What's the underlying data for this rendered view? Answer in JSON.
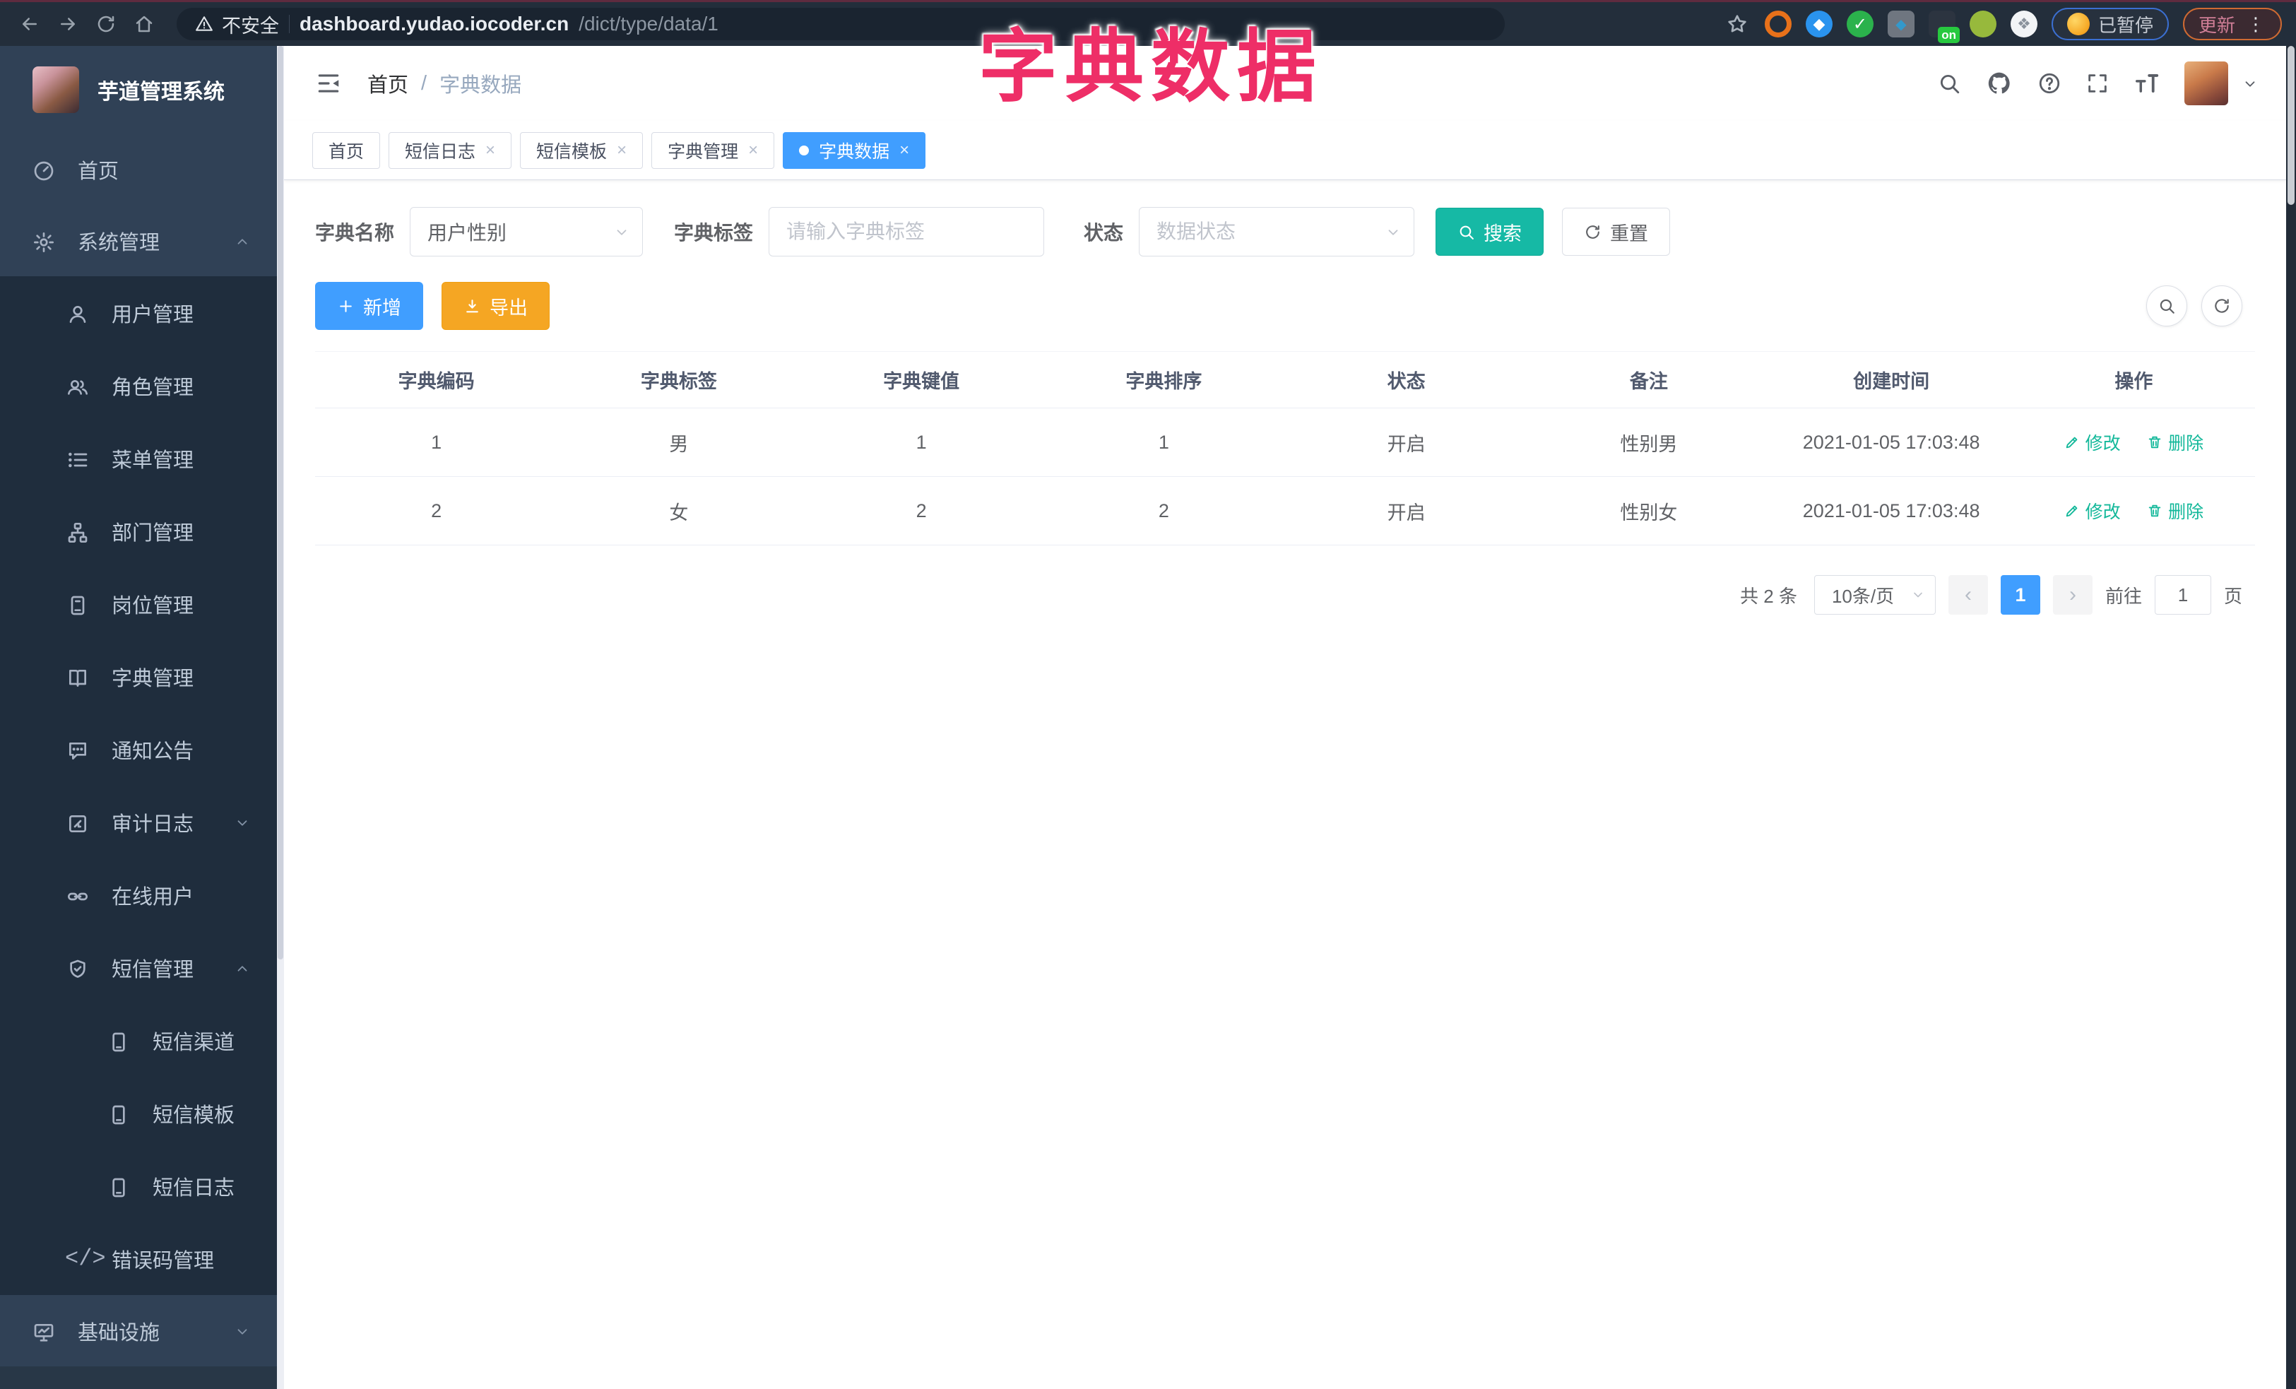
{
  "browser": {
    "security_label": "不安全",
    "url_domain": "dashboard.yudao.iocoder.cn",
    "url_path": "/dict/type/data/1",
    "ext_on_badge": "on",
    "paused_label": "已暂停",
    "update_label": "更新"
  },
  "overlay_title": "字典数据",
  "sidebar": {
    "app_title": "芋道管理系统",
    "items": [
      {
        "label": "首页"
      },
      {
        "label": "系统管理"
      },
      {
        "label": "用户管理"
      },
      {
        "label": "角色管理"
      },
      {
        "label": "菜单管理"
      },
      {
        "label": "部门管理"
      },
      {
        "label": "岗位管理"
      },
      {
        "label": "字典管理"
      },
      {
        "label": "通知公告"
      },
      {
        "label": "审计日志"
      },
      {
        "label": "在线用户"
      },
      {
        "label": "短信管理"
      },
      {
        "label": "短信渠道"
      },
      {
        "label": "短信模板"
      },
      {
        "label": "短信日志"
      },
      {
        "label": "错误码管理"
      },
      {
        "label": "基础设施"
      }
    ]
  },
  "breadcrumb": {
    "home": "首页",
    "sep": "/",
    "current": "字典数据"
  },
  "tabs": [
    {
      "label": "首页"
    },
    {
      "label": "短信日志"
    },
    {
      "label": "短信模板"
    },
    {
      "label": "字典管理"
    },
    {
      "label": "字典数据"
    }
  ],
  "filters": {
    "dict_name_label": "字典名称",
    "dict_name_value": "用户性别",
    "dict_label_label": "字典标签",
    "dict_label_placeholder": "请输入字典标签",
    "status_label": "状态",
    "status_placeholder": "数据状态",
    "search_label": "搜索",
    "reset_label": "重置"
  },
  "toolbar": {
    "add_label": "新增",
    "export_label": "导出"
  },
  "table": {
    "headers": [
      "字典编码",
      "字典标签",
      "字典键值",
      "字典排序",
      "状态",
      "备注",
      "创建时间",
      "操作"
    ],
    "rows": [
      {
        "code": "1",
        "label": "男",
        "value": "1",
        "sort": "1",
        "status": "开启",
        "remark": "性别男",
        "created": "2021-01-05 17:03:48"
      },
      {
        "code": "2",
        "label": "女",
        "value": "2",
        "sort": "2",
        "status": "开启",
        "remark": "性别女",
        "created": "2021-01-05 17:03:48"
      }
    ],
    "edit_label": "修改",
    "delete_label": "删除"
  },
  "pagination": {
    "total_text": "共 2 条",
    "page_size": "10条/页",
    "current_page": "1",
    "goto_label": "前往",
    "goto_value": "1",
    "page_unit": "页"
  },
  "colors": {
    "primary": "#409eff",
    "teal": "#16b9a5",
    "warning": "#f5a623",
    "overlay_pink": "#ee2e67",
    "sidebar_bg": "#304156",
    "submenu_bg": "#1f2d3d"
  }
}
